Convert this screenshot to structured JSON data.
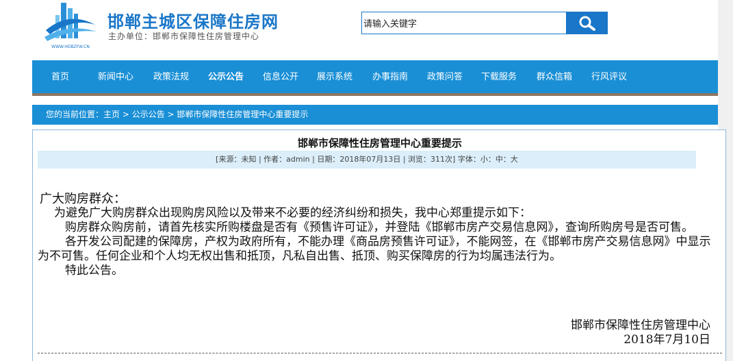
{
  "header": {
    "site_title": "邯郸主城区保障住房网",
    "site_subtitle": "主办单位：邯郸市保障性住房管理中心",
    "logo_text": "WWW.HDBZFW.CN",
    "search_value": "请输入关键字"
  },
  "nav": {
    "items": [
      {
        "label": "首页"
      },
      {
        "label": "新闻中心"
      },
      {
        "label": "政策法规"
      },
      {
        "label": "公示公告"
      },
      {
        "label": "信息公开"
      },
      {
        "label": "展示系统"
      },
      {
        "label": "办事指南"
      },
      {
        "label": "政策问答"
      },
      {
        "label": "下载服务"
      },
      {
        "label": "群众信箱"
      },
      {
        "label": "行风评议"
      }
    ],
    "active_index": 3
  },
  "breadcrumb": {
    "prefix": "您的当前位置：",
    "home": "主页",
    "sep": " > ",
    "category": "公示公告",
    "current": "邯郸市保障性住房管理中心重要提示"
  },
  "article": {
    "title": "邯郸市保障性住房管理中心重要提示",
    "meta": {
      "source_label": "[来源：",
      "source": "未知",
      "author_label": " | 作者：",
      "author": "admin",
      "date_label": " | 日期：",
      "date": "2018年07月13日",
      "views_label": " | 浏览：",
      "views": "311",
      "views_suffix": "次]",
      "font_label": " 字体：",
      "font_small": "小",
      "font_medium": "中",
      "font_large": "大",
      "font_sep": "："
    },
    "greeting": "广大购房群众：",
    "paragraphs": [
      "为避免广大购房群众出现购房风险以及带来不必要的经济纠纷和损失，我中心郑重提示如下：",
      "购房群众购房前，请首先核实所购楼盘是否有《预售许可证》，并登陆《邯郸市房产交易信息网》，查询所购房号是否可售。",
      "各开发公司配建的保障房，产权为政府所有，不能办理《商品房预售许可证》，不能网签，在《邯郸市房产交易信息网》中显示为不可售。任何企业和个人均无权出售和抵顶，凡私自出售、抵顶、购买保障房的行为均属违法行为。",
      "特此公告。"
    ],
    "signature_org": "邯郸市保障性住房管理中心",
    "signature_date": "2018年7月10日"
  },
  "colors": {
    "brand_blue": "#1a8fd6",
    "nav_border": "#8c7561",
    "meta_bg": "#dbeef9"
  }
}
